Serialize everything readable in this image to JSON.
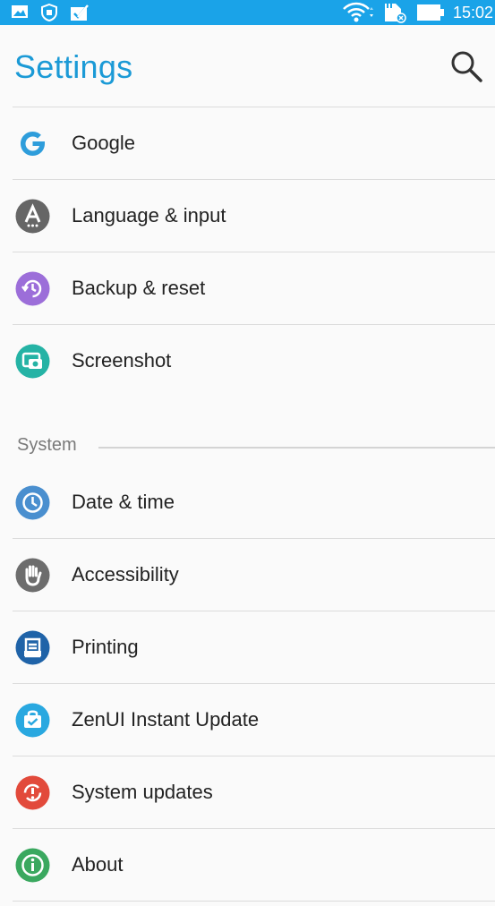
{
  "status_bar": {
    "time": "15:02",
    "left_icons": [
      "image-icon",
      "shield-icon",
      "clipboard-check-icon"
    ],
    "right_icons": [
      "wifi-icon",
      "sim-icon",
      "battery-icon"
    ],
    "background": "#1aa3e8"
  },
  "app_bar": {
    "title": "Settings",
    "title_color": "#1b9ad6",
    "search_icon": "search-icon"
  },
  "personal_items": [
    {
      "label": "Google",
      "icon": "google-icon",
      "color": "#2e9ddb"
    },
    {
      "label": "Language & input",
      "icon": "language-icon",
      "color": "#666666"
    },
    {
      "label": "Backup & reset",
      "icon": "backup-icon",
      "color": "#9c6ed9"
    },
    {
      "label": "Screenshot",
      "icon": "screenshot-icon",
      "color": "#25b3a5"
    }
  ],
  "system_section": {
    "title": "System",
    "items": [
      {
        "label": "Date & time",
        "icon": "clock-icon",
        "color": "#4a8fcf"
      },
      {
        "label": "Accessibility",
        "icon": "hand-icon",
        "color": "#6d6d6d"
      },
      {
        "label": "Printing",
        "icon": "printer-icon",
        "color": "#1f63a8"
      },
      {
        "label": "ZenUI Instant Update",
        "icon": "update-bag-icon",
        "color": "#29a8e0"
      },
      {
        "label": "System updates",
        "icon": "system-update-icon",
        "color": "#e24a3b"
      },
      {
        "label": "About",
        "icon": "info-icon",
        "color": "#3aa85f"
      }
    ]
  }
}
